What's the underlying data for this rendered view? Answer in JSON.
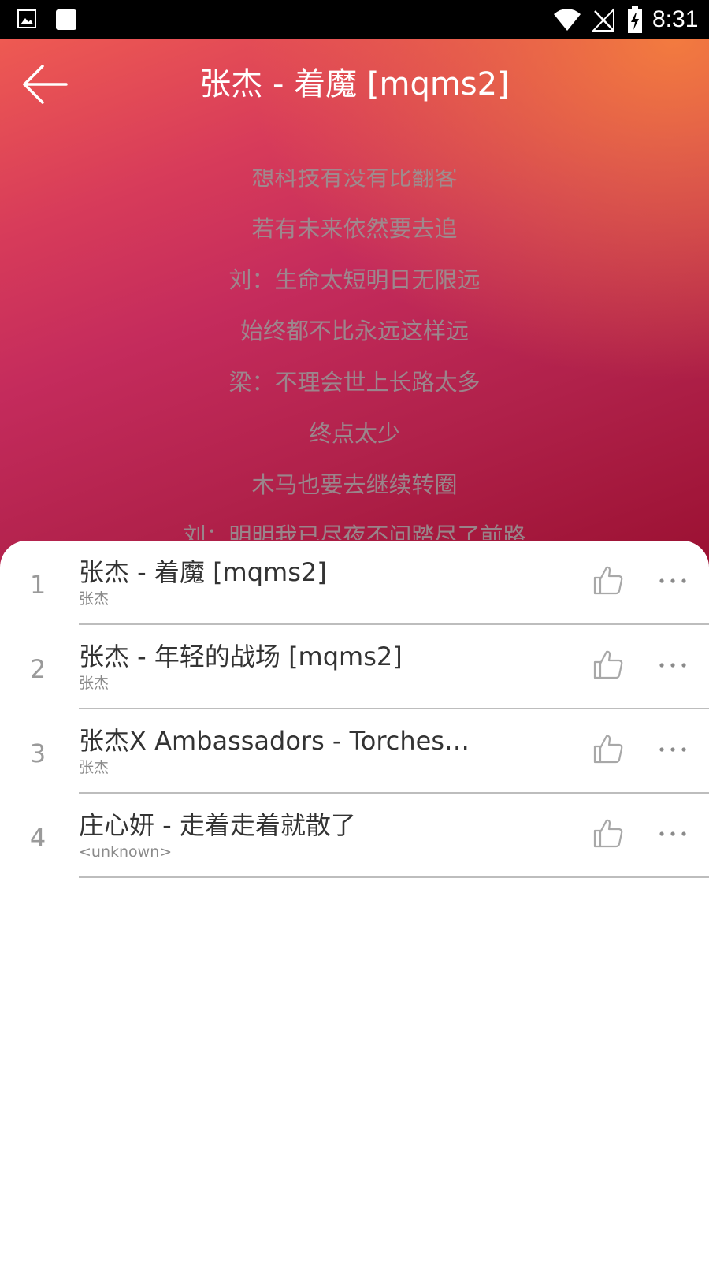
{
  "status_bar": {
    "time": "8:31"
  },
  "header": {
    "title": "张杰 - 着魔 [mqms2]"
  },
  "lyrics": [
    "想科技有没有比翻客",
    "若有未来依然要去追",
    "刘：生命太短明日无限远",
    "始终都不比永远这样远",
    "梁：不理会世上长路太多",
    "终点太少",
    "木马也要去继续转圈",
    "刘：明明我已尽夜不问踏尽了前路"
  ],
  "playlist": [
    {
      "index": "1",
      "title": "张杰 - 着魔 [mqms2]",
      "artist": "张杰"
    },
    {
      "index": "2",
      "title": "张杰 - 年轻的战场 [mqms2]",
      "artist": "张杰"
    },
    {
      "index": "3",
      "title": "张杰X Ambassadors - Torches…",
      "artist": "张杰"
    },
    {
      "index": "4",
      "title": "庄心妍 - 走着走着就散了",
      "artist": "<unknown>"
    }
  ],
  "icons": {
    "back": "arrow-left-icon",
    "like": "thumbs-up-icon",
    "more": "more-dots-icon"
  },
  "colors": {
    "gradient_top": "#ee5a52",
    "gradient_bottom": "#9a1031",
    "accent_orange": "#f6823c"
  }
}
